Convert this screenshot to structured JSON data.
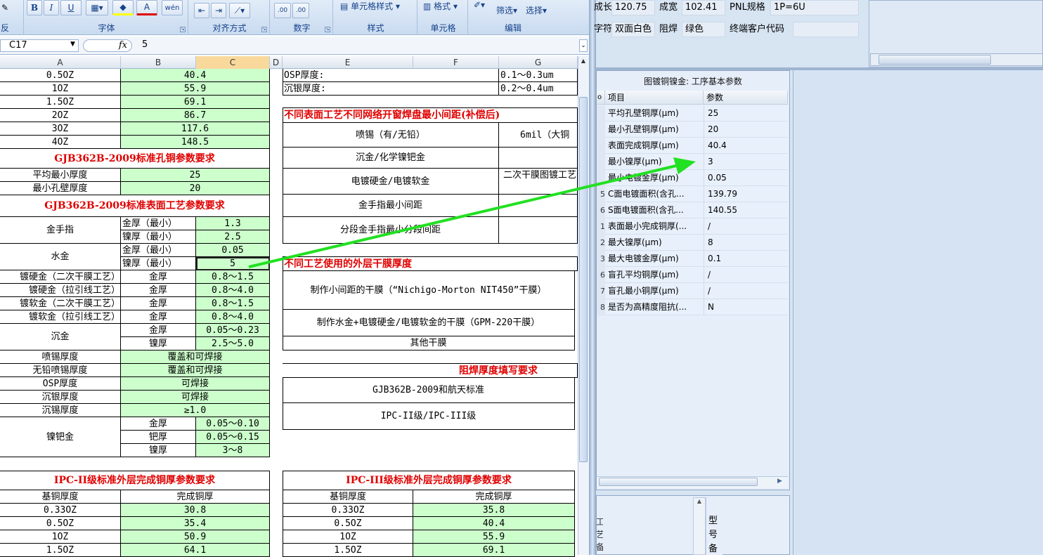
{
  "ribbon": {
    "bold": "B",
    "italic": "I",
    "underline": "U",
    "wen": "wén",
    "font_color_label": "A",
    "groups": {
      "font": "字体",
      "align": "对齐方式",
      "number": "数字",
      "style": "样式",
      "cells": "单元格",
      "edit": "编辑"
    },
    "cell_style": "单元格样式",
    "format": "格式",
    "filter": "筛选",
    "select": "选择",
    "dec_inc": ".00",
    "dec_dec": ".00",
    "left_cut": "反"
  },
  "formula_bar": {
    "name_box": "C17",
    "fx": "fx",
    "value": "5"
  },
  "columns": [
    "A",
    "B",
    "C",
    "D",
    "E",
    "F",
    "G"
  ],
  "left_table": {
    "rows1": [
      [
        "0.5OZ",
        "40.4"
      ],
      [
        "1OZ",
        "55.9"
      ],
      [
        "1.5OZ",
        "69.1"
      ],
      [
        "2OZ",
        "86.7"
      ],
      [
        "3OZ",
        "117.6"
      ],
      [
        "4OZ",
        "148.5"
      ]
    ],
    "gjb_title": "GJB362B-2009标准孔铜参数要求",
    "gjb_rows": [
      [
        "平均最小厚度",
        "25"
      ],
      [
        "最小孔壁厚度",
        "20"
      ]
    ],
    "surf_title": "GJB362B-2009标准表面工艺参数要求",
    "gold_finger": "金手指",
    "water_gold": "水金",
    "sub_gold_thick": "金厚（最小）",
    "sub_ni_thick": "镍厚（最小）",
    "gf_vals": [
      "1.3",
      "2.5"
    ],
    "wg_vals": [
      "0.05",
      "5"
    ],
    "plate_rows": [
      [
        "镀硬金（二次干膜工艺）",
        "金厚",
        "0.8～1.5"
      ],
      [
        "镀硬金（拉引线工艺）",
        "金厚",
        "0.8～4.0"
      ],
      [
        "镀软金（二次干膜工艺）",
        "金厚",
        "0.8～1.5"
      ],
      [
        "镀软金（拉引线工艺）",
        "金厚",
        "0.8～4.0"
      ]
    ],
    "enig": "沉金",
    "enig_rows": [
      [
        "金厚",
        "0.05～0.23"
      ],
      [
        "镍厚",
        "2.5～5.0"
      ]
    ],
    "misc_rows": [
      [
        "喷锡厚度",
        "覆盖和可焊接"
      ],
      [
        "无铅喷锡厚度",
        "覆盖和可焊接"
      ],
      [
        "OSP厚度",
        "可焊接"
      ],
      [
        "沉银厚度",
        "可焊接"
      ],
      [
        "沉锡厚度",
        "≥1.0"
      ]
    ],
    "enepig": "镍钯金",
    "enepig_rows": [
      [
        "金厚",
        "0.05～0.10"
      ],
      [
        "钯厚",
        "0.05～0.15"
      ],
      [
        "镍厚",
        "3～8"
      ]
    ],
    "ipc2_title": "IPC-II级标准外层完成铜厚参数要求",
    "ipc_hdr": [
      "基铜厚度",
      "完成铜厚"
    ],
    "ipc2_rows": [
      [
        "0.33OZ",
        "30.8"
      ],
      [
        "0.5OZ",
        "35.4"
      ],
      [
        "1OZ",
        "50.9"
      ],
      [
        "1.5OZ",
        "64.1"
      ]
    ]
  },
  "right_table": {
    "osp_rows": [
      [
        "OSP厚度:",
        "0.1～0.3um"
      ],
      [
        "沉银厚度:",
        "0.2～0.4um"
      ]
    ],
    "spacing_title": "不同表面工艺不同网络开窗焊盘最小间距(补偿后)",
    "spacing_rows": [
      [
        "喷锡（有/无铅）",
        "6mil（大铜"
      ],
      [
        "沉金/化学镍钯金",
        ""
      ],
      [
        "电镀硬金/电镀软金",
        "二次干膜图镀工艺"
      ],
      [
        "金手指最小间距",
        ""
      ],
      [
        "分段金手指最小分段间距",
        ""
      ]
    ],
    "dryfilm_title": "不同工艺使用的外层干膜厚度",
    "dryfilm_rows": [
      "制作小间距的干膜（“Nichigo-Morton NIT450”干膜）",
      "制作水金+电镀硬金/电镀软金的干膜（GPM-220干膜）",
      "其他干膜"
    ],
    "mask_title": "阻焊厚度填写要求",
    "mask_rows": [
      "GJB362B-2009和航天标准",
      "IPC-II级/IPC-III级"
    ],
    "ipc3_title": "IPC-III级标准外层完成铜厚参数要求",
    "ipc3_rows": [
      [
        "0.33OZ",
        "35.8"
      ],
      [
        "0.5OZ",
        "40.4"
      ],
      [
        "1OZ",
        "55.9"
      ],
      [
        "1.5OZ",
        "69.1"
      ]
    ]
  },
  "app": {
    "fields": [
      {
        "label": "成长",
        "value": "120.75"
      },
      {
        "label": "成宽",
        "value": "102.41"
      },
      {
        "label": "PNL规格",
        "value": "1P=6U"
      },
      {
        "label": "字符",
        "value": "双面白色"
      },
      {
        "label": "阻焊",
        "value": "绿色"
      },
      {
        "label": "终端客户代码",
        "value": ""
      }
    ],
    "panel_title": "图镀铜镍金: 工序基本参数",
    "panel_headers": [
      "项目",
      "参数"
    ],
    "panel_rows": [
      {
        "n": "",
        "item": "平均孔壁铜厚(μm)",
        "val": "25"
      },
      {
        "n": "",
        "item": "最小孔壁铜厚(μm)",
        "val": "20"
      },
      {
        "n": "",
        "item": "表面完成铜厚(μm)",
        "val": "40.4"
      },
      {
        "n": "",
        "item": "最小镍厚(μm)",
        "val": "3"
      },
      {
        "n": "",
        "item": "最小电镀金厚(μm)",
        "val": "0.05"
      },
      {
        "n": "5",
        "item": "C面电镀面积(含孔...",
        "val": "139.79"
      },
      {
        "n": "6",
        "item": "S面电镀面积(含孔...",
        "val": "140.55"
      },
      {
        "n": "1",
        "item": "表面最小完成铜厚(...",
        "val": "/"
      },
      {
        "n": "2",
        "item": "最大镍厚(μm)",
        "val": "8"
      },
      {
        "n": "3",
        "item": "最大电镀金厚(μm)",
        "val": "0.1"
      },
      {
        "n": "6",
        "item": "盲孔平均铜厚(μm)",
        "val": "/"
      },
      {
        "n": "7",
        "item": "盲孔最小铜厚(μm)",
        "val": "/"
      },
      {
        "n": "8",
        "item": "是否为高精度阻抗(...",
        "val": "N"
      }
    ],
    "bottom_label": "型号备",
    "bottom_left": "工艺备"
  },
  "annotation": {
    "arrow_color": "#22e022"
  }
}
